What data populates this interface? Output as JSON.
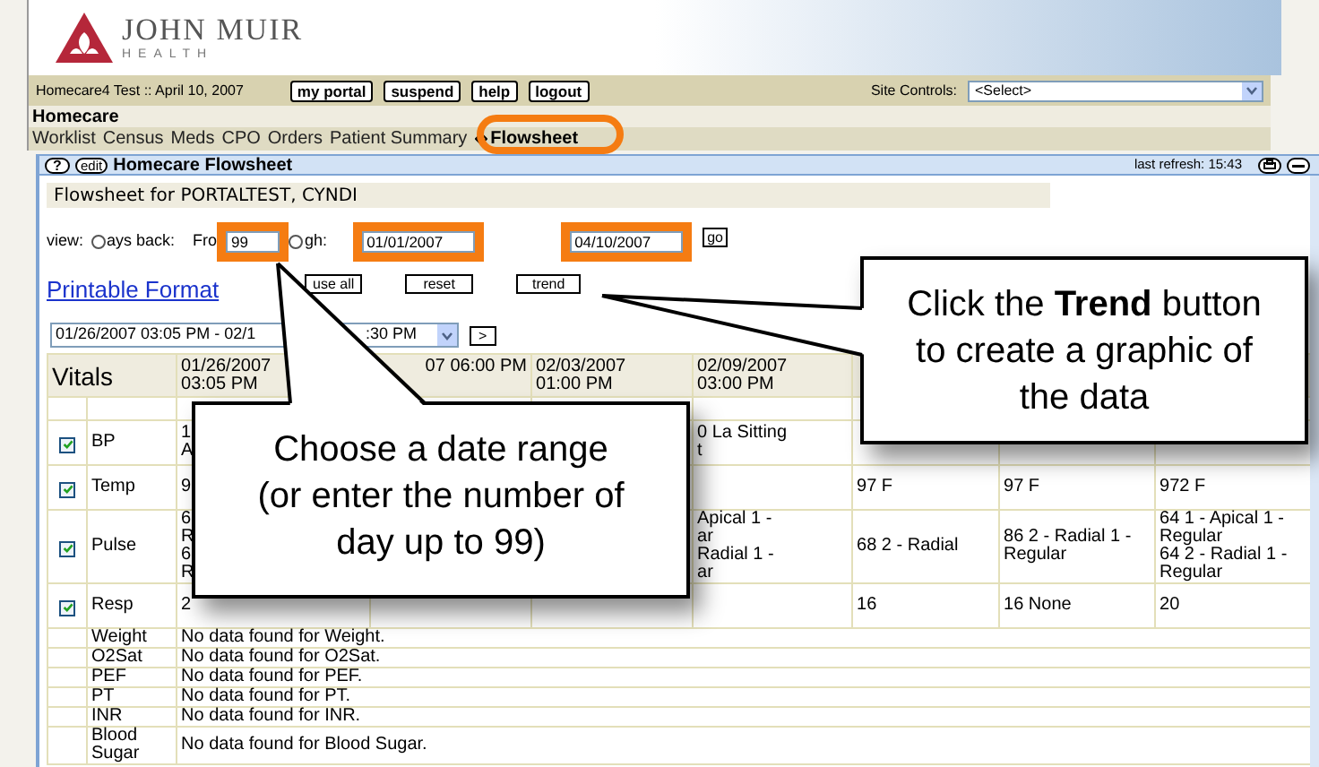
{
  "logo": {
    "name": "JOHN MUIR",
    "tagline": "HEALTH"
  },
  "status_bar": {
    "user": "Homecare4 Test :: April 10, 2007",
    "buttons": [
      "my portal",
      "suspend",
      "help",
      "logout"
    ],
    "site_controls_label": "Site Controls:",
    "site_controls_value": "<Select>"
  },
  "section": "Homecare",
  "nav": [
    {
      "label": "Worklist",
      "selected": false
    },
    {
      "label": "Census",
      "selected": false
    },
    {
      "label": "Meds",
      "selected": false
    },
    {
      "label": "CPO",
      "selected": false
    },
    {
      "label": "Orders",
      "selected": false
    },
    {
      "label": "Patient Summary",
      "selected": false
    },
    {
      "label": "Flowsheet",
      "selected": true
    }
  ],
  "panel": {
    "help": "?",
    "edit": "edit",
    "title": "Homecare Flowsheet",
    "last_refresh": "last refresh: 15:43"
  },
  "patient_line": "Flowsheet for PORTALTEST, CYNDI",
  "view": {
    "label": "view:",
    "radios": [
      {
        "selected": false
      },
      {
        "selected": false
      }
    ],
    "days_label": "ays back:",
    "from_label": "Fro",
    "days": "99",
    "through_label": "gh:",
    "from_date": "01/01/2007",
    "to_date": "04/10/2007",
    "go": "go"
  },
  "actions": {
    "printable": "Printable Format",
    "buttons": [
      "use all",
      "reset",
      "trend"
    ]
  },
  "range": {
    "text_start": "01/26/2007 03:05 PM - 02/1",
    "text_end": ":30 PM",
    "next": ">"
  },
  "table": {
    "title": "Vitals",
    "columns": [
      [
        "01/26/2007",
        "03:05 PM"
      ],
      [
        "07 06:00 PM"
      ],
      [
        "02/03/2007",
        "01:00 PM"
      ],
      [
        "02/09/2007",
        "03:00 PM"
      ]
    ],
    "rows": [
      {
        "kind": "check",
        "label": "BP",
        "checked": true,
        "cells": [
          "1\nA",
          null,
          null,
          "0 La Sitting\nt",
          null,
          null,
          null
        ]
      },
      {
        "kind": "check",
        "label": "Temp",
        "checked": true,
        "cells": [
          "9",
          null,
          null,
          null,
          "97 F",
          "97 F",
          "972 F"
        ]
      },
      {
        "kind": "check",
        "label": "Pulse",
        "checked": true,
        "cells": [
          "6\nR\n6\nR",
          null,
          null,
          "Apical 1 -\nar\nRadial 1 -\nar",
          "68 2 - Radial",
          "86 2 - Radial 1 - Regular",
          "64 1 - Apical 1 - Regular\n64 2 - Radial 1 - Regular"
        ]
      },
      {
        "kind": "check",
        "label": "Resp",
        "checked": true,
        "cells": [
          "2",
          null,
          null,
          null,
          "16",
          "16 None",
          "20"
        ]
      },
      {
        "kind": "message",
        "label": "Weight",
        "message": "No data found for Weight."
      },
      {
        "kind": "message",
        "label": "O2Sat",
        "message": "No data found for O2Sat."
      },
      {
        "kind": "message",
        "label": "PEF",
        "message": "No data found for PEF."
      },
      {
        "kind": "message",
        "label": "PT",
        "message": "No data found for PT."
      },
      {
        "kind": "message",
        "label": "INR",
        "message": "No data found for INR."
      },
      {
        "kind": "message",
        "label": "Blood Sugar",
        "message": "No data found for Blood Sugar."
      }
    ]
  },
  "callouts": [
    {
      "text": "Choose a date range (or enter the number of day up to 99)"
    },
    {
      "text": "Click the **Trend** button to create a graphic of the data"
    }
  ]
}
